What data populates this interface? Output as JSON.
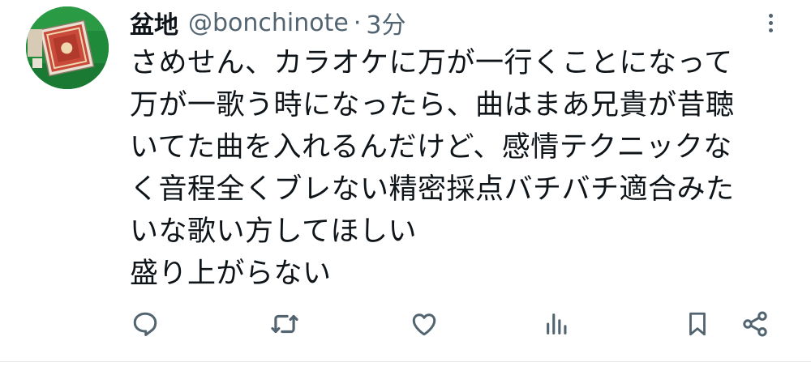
{
  "tweet": {
    "author": {
      "display_name": "盆地",
      "handle": "@bonchinote"
    },
    "separator": "·",
    "time": "3分",
    "lines": [
      "さめせん、カラオケに万が一行くことになって",
      "万が一歌う時になったら、曲はまあ兄貴が昔聴",
      "いてた曲を入れるんだけど、感情テクニックな",
      "く音程全くブレない精密採点バチバチ適合みた",
      "いな歌い方してほしい",
      "盛り上がらない"
    ],
    "actions": [
      "reply-icon",
      "retweet-icon",
      "like-icon",
      "views-icon",
      "bookmark-icon",
      "share-icon"
    ],
    "colors": {
      "text": "#0f1419",
      "secondary": "#536471",
      "avatar_bg": "#1f8a3a"
    }
  }
}
